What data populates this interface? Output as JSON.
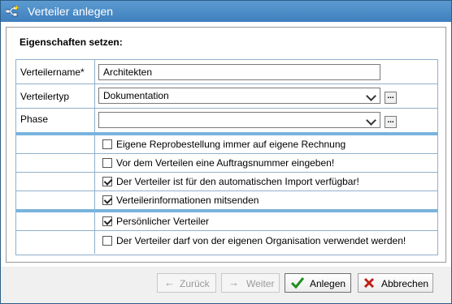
{
  "window": {
    "title": "Verteiler anlegen",
    "icon": "distribution-list-add-icon"
  },
  "panel": {
    "title": "Eigenschaften setzen:",
    "fields": {
      "name": {
        "label": "Verteilername*",
        "value": "Architekten"
      },
      "type": {
        "label": "Verteilertyp",
        "value": "Dokumentation",
        "more": "..."
      },
      "phase": {
        "label": "Phase",
        "value": "",
        "more": "..."
      }
    },
    "options_group1": [
      {
        "label": "Eigene Reprobestellung immer auf eigene Rechnung",
        "checked": false
      },
      {
        "label": "Vor dem Verteilen eine Auftragsnummer eingeben!",
        "checked": false
      },
      {
        "label": "Der Verteiler ist für den automatischen Import verfügbar!",
        "checked": true
      },
      {
        "label": "Verteilerinformationen mitsenden",
        "checked": true
      }
    ],
    "options_group2": [
      {
        "label": "Persönlicher Verteiler",
        "checked": true
      },
      {
        "label": "Der Verteiler darf von der eigenen Organisation verwendet werden!",
        "checked": false
      }
    ]
  },
  "buttons": {
    "back": {
      "label": "Zurück",
      "enabled": false
    },
    "next": {
      "label": "Weiter",
      "enabled": false
    },
    "create": {
      "label": "Anlegen",
      "enabled": true
    },
    "cancel": {
      "label": "Abbrechen",
      "enabled": true
    }
  },
  "colors": {
    "titlebar": "#4a8cc8",
    "separator": "#79b3dd",
    "grid_border": "#8fb0cc",
    "create_check": "#1f8f1f",
    "cancel_x": "#c0201a"
  }
}
